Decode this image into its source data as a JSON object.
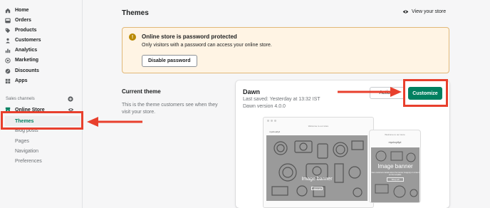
{
  "sidebar": {
    "items": [
      {
        "label": "Home",
        "icon": "home-icon"
      },
      {
        "label": "Orders",
        "icon": "orders-icon"
      },
      {
        "label": "Products",
        "icon": "tag-icon"
      },
      {
        "label": "Customers",
        "icon": "person-icon"
      },
      {
        "label": "Analytics",
        "icon": "bar-chart-icon"
      },
      {
        "label": "Marketing",
        "icon": "target-icon"
      },
      {
        "label": "Discounts",
        "icon": "discount-icon"
      },
      {
        "label": "Apps",
        "icon": "apps-icon"
      }
    ],
    "sales_channels_title": "Sales channels",
    "online_store": {
      "label": "Online Store",
      "subitems": [
        "Themes",
        "Blog posts",
        "Pages",
        "Navigation",
        "Preferences"
      ],
      "active": "Themes"
    }
  },
  "header": {
    "title": "Themes",
    "view_store": "View your store"
  },
  "banner": {
    "title": "Online store is password protected",
    "text": "Only visitors with a password can access your online store.",
    "button": "Disable password",
    "icon": "warning-icon"
  },
  "current_theme": {
    "title": "Current theme",
    "description": "This is the theme customers see when they visit your store."
  },
  "theme_card": {
    "name": "Dawn",
    "last_saved": "Last saved: Yesterday at 13:32 IST",
    "version": "Dawn version 4.0.0",
    "actions_label": "Actions",
    "customize_label": "Customize",
    "desktop_preview": {
      "announcement": "Welcome to our store",
      "store_name": "myshopifyd",
      "banner_label": "Image banner",
      "button": "Shop all"
    },
    "mobile_preview": {
      "announcement": "Welcome to our store",
      "store_name": "myshopifyd",
      "banner_label": "Image banner",
      "subtitle": "Give customers details about the banner image(s) or content on the template.",
      "button": "Shop all"
    }
  },
  "colors": {
    "accent_green": "#008060",
    "annotation_red": "#e8402d",
    "banner_bg": "#fff4e4",
    "banner_border": "#e1b878"
  }
}
